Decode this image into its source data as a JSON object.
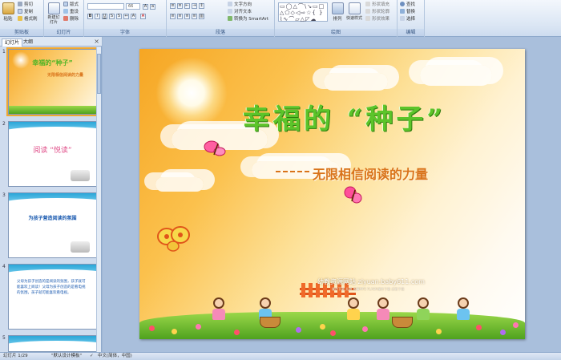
{
  "ribbon": {
    "clipboard": {
      "label": "剪贴板",
      "paste": "粘贴",
      "cut": "剪切",
      "copy": "复制",
      "format_painter": "格式刷"
    },
    "slides": {
      "label": "幻灯片",
      "new_slide": "新建幻灯片",
      "layout": "版式",
      "reset": "重设",
      "delete": "删除"
    },
    "font": {
      "label": "字体",
      "font_name": "",
      "font_size": "66"
    },
    "paragraph": {
      "label": "段落",
      "text_direction": "文字方向",
      "align_text": "对齐文本",
      "smartart": "转换为 SmartArt"
    },
    "drawing": {
      "label": "绘图",
      "arrange": "排列",
      "quick_styles": "快速样式",
      "shape_fill": "形状填充",
      "shape_outline": "形状轮廓",
      "shape_effects": "形状效果"
    },
    "editing": {
      "label": "编辑",
      "find": "查找",
      "replace": "替换",
      "select": "选择"
    }
  },
  "panel": {
    "tabs": [
      "幻灯片",
      "大纲"
    ],
    "close": "×",
    "thumbnails": [
      {
        "number": "1",
        "title": "幸福的“种子”",
        "subtitle": "无限相信阅读的力量"
      },
      {
        "number": "2",
        "text": "阅读  “悦读”"
      },
      {
        "number": "3",
        "text": "为孩子营造阅读的氛围"
      },
      {
        "number": "4",
        "text": "父母为孩子创造的是阅读的氛围，孩子就可能喜欢上阅读！父母为孩子创造的是看电视的氛围，孩子就可能喜欢看电视。"
      },
      {
        "number": "5",
        "text": ""
      }
    ]
  },
  "slide": {
    "title": "幸福的  “种子”",
    "subtitle": "无限相信阅读的力量",
    "watermark": "幼教资源网站  ziyuan.baby611.com",
    "watermark_small": "课件下载  儿歌  故事MP3  FLASH课件下载  试卷下载"
  },
  "status": {
    "slide_counter": "幻灯片 1/29",
    "theme": "\"默认设计模板\"",
    "language": "中文(简体，中国)"
  }
}
